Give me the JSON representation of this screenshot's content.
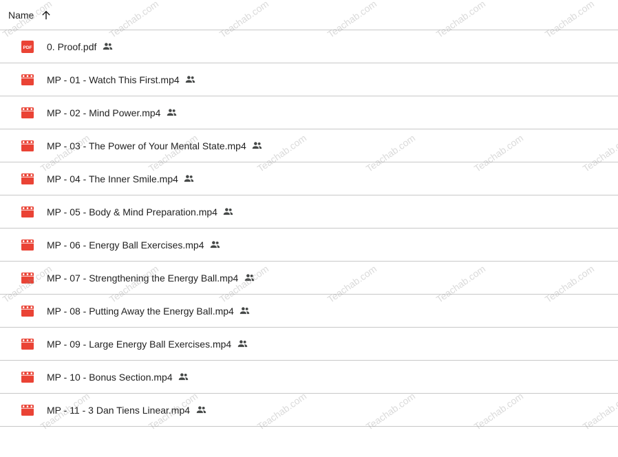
{
  "header": {
    "name_label": "Name"
  },
  "files": [
    {
      "name": "0. Proof.pdf",
      "type": "pdf",
      "shared": true
    },
    {
      "name": "MP - 01 - Watch This First.mp4",
      "type": "video",
      "shared": true
    },
    {
      "name": "MP - 02 - Mind Power.mp4",
      "type": "video",
      "shared": true
    },
    {
      "name": "MP - 03 - The Power of Your Mental State.mp4",
      "type": "video",
      "shared": true
    },
    {
      "name": "MP - 04 - The Inner Smile.mp4",
      "type": "video",
      "shared": true
    },
    {
      "name": "MP - 05 - Body & Mind Preparation.mp4",
      "type": "video",
      "shared": true
    },
    {
      "name": "MP - 06 - Energy Ball Exercises.mp4",
      "type": "video",
      "shared": true
    },
    {
      "name": "MP - 07 - Strengthening the Energy Ball.mp4",
      "type": "video",
      "shared": true
    },
    {
      "name": "MP - 08 - Putting Away the Energy Ball.mp4",
      "type": "video",
      "shared": true
    },
    {
      "name": "MP - 09 - Large Energy Ball Exercises.mp4",
      "type": "video",
      "shared": true
    },
    {
      "name": "MP - 10 - Bonus Section.mp4",
      "type": "video",
      "shared": true
    },
    {
      "name": "MP - 11 - 3 Dan Tiens Linear.mp4",
      "type": "video",
      "shared": true
    }
  ],
  "pdf_icon_label": "PDF",
  "watermark_text": "Teachab.com",
  "colors": {
    "icon_red": "#ea4335",
    "text": "#1f1f1f",
    "divider": "#c7c7c7",
    "shared_icon": "#444746"
  },
  "icons": {
    "sort": "arrow-upward-icon",
    "pdf": "pdf-file-icon",
    "video": "video-file-icon",
    "shared": "people-icon"
  }
}
